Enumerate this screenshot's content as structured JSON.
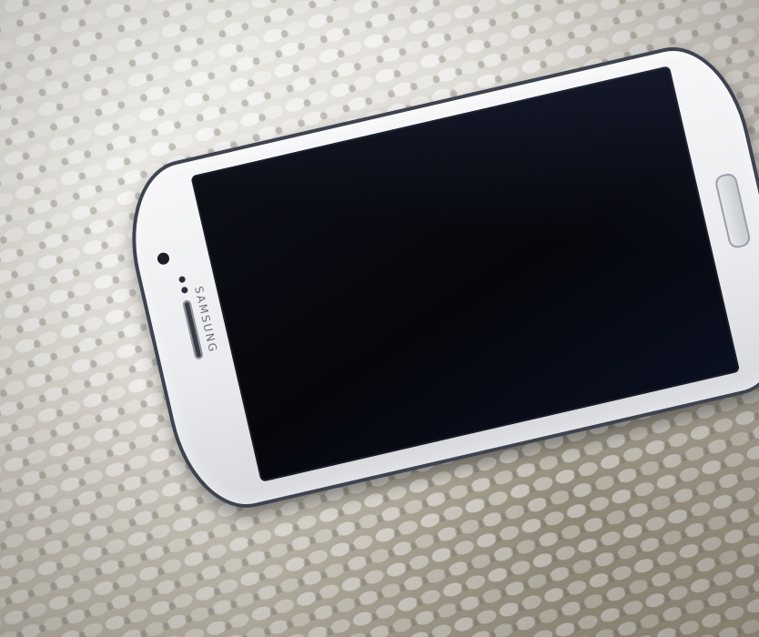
{
  "phone": {
    "brand_text": "SAMSUNG"
  }
}
